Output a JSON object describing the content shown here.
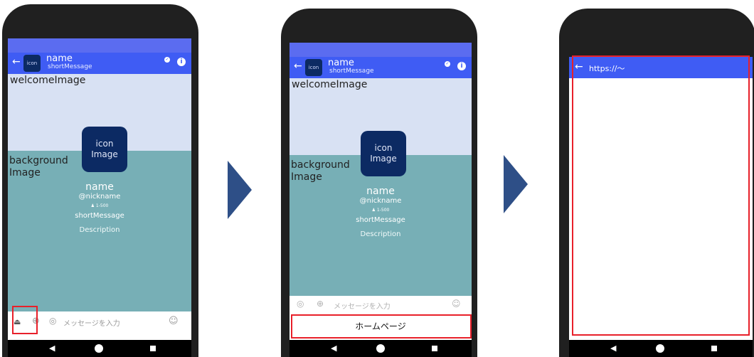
{
  "profile": {
    "header_icon": "icon",
    "name": "name",
    "short_message": "shortMessage",
    "welcome_image": "welcomeImage",
    "background_line1": "background",
    "background_line2": "Image",
    "icon_line1": "icon",
    "icon_line2": "Image",
    "nickname": "@nickname",
    "followers": "♟ 1-500",
    "description": "Description",
    "input_placeholder": "メッセージを入力"
  },
  "screen2": {
    "homepage_button": "ホームページ"
  },
  "screen3": {
    "url": "https://～"
  },
  "icons": {
    "back": "←",
    "check": "✓",
    "info": "i",
    "attach": "⏏",
    "plus": "⊕",
    "camera": "◎",
    "sticker": "☺",
    "nav_back": "◀"
  },
  "colors": {
    "header_blue": "#3f5cf4",
    "welcome_bg": "#d8e1f3",
    "background_teal": "#77afb6",
    "icon_navy": "#0c2a63",
    "highlight_red": "#e8202a",
    "arrow_navy": "#2e4f87"
  }
}
